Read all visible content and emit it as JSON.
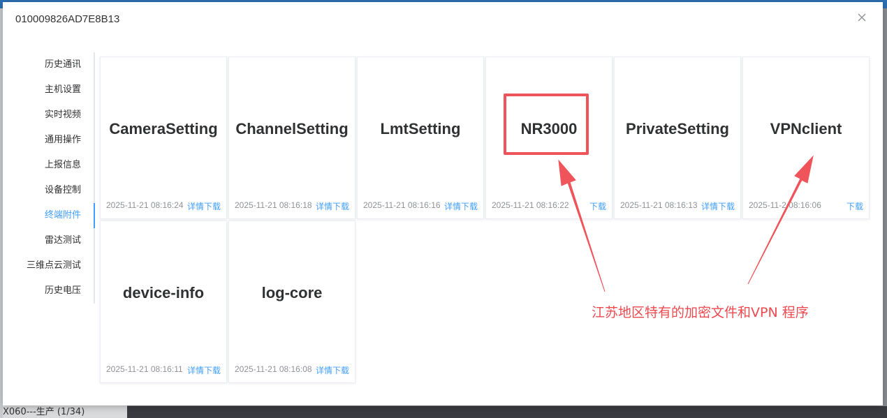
{
  "background": {
    "strip_text": "X060---生产 (1/34)"
  },
  "modal": {
    "title": "010009826AD7E8B13",
    "close_icon": "close-icon"
  },
  "side_menu": {
    "items": [
      {
        "label": "历史通讯"
      },
      {
        "label": "主机设置"
      },
      {
        "label": "实时视频"
      },
      {
        "label": "通用操作"
      },
      {
        "label": "上报信息"
      },
      {
        "label": "设备控制"
      },
      {
        "label": "终端附件",
        "active": true
      },
      {
        "label": "雷达测试"
      },
      {
        "label": "三维点云测试"
      },
      {
        "label": "历史电压"
      }
    ]
  },
  "cards": [
    {
      "name": "CameraSetting",
      "date": "2025-11-21 08:16:24",
      "detail": "详情",
      "download": "下载"
    },
    {
      "name": "ChannelSetting",
      "date": "2025-11-21 08:16:18",
      "detail": "详情",
      "download": "下载"
    },
    {
      "name": "LmtSetting",
      "date": "2025-11-21 08:16:16",
      "detail": "详情",
      "download": "下载"
    },
    {
      "name": "NR3000",
      "date": "2025-11-21 08:16:22",
      "detail": "",
      "download": "下载"
    },
    {
      "name": "PrivateSetting",
      "date": "2025-11-21 08:16:13",
      "detail": "详情",
      "download": "下载"
    },
    {
      "name": "VPNclient",
      "date": "2025-11-2  08:16:06",
      "detail": "",
      "download": "下载"
    },
    {
      "name": "device-info",
      "date": "2025-11-21 08:16:11",
      "detail": "详情",
      "download": "下载"
    },
    {
      "name": "log-core",
      "date": "2025-11-21 08:16:08",
      "detail": "详情",
      "download": "下载"
    }
  ],
  "annotation": {
    "text": "江苏地区特有的加密文件和VPN 程序",
    "color": "#ee4a4f"
  },
  "colors": {
    "accent": "#409eff",
    "annotation": "#f0545b"
  }
}
